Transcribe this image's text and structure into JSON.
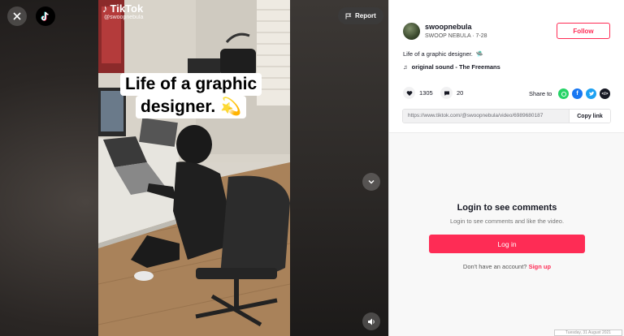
{
  "video": {
    "report_label": "Report",
    "watermark_brand": "TikTok",
    "watermark_handle": "@swoopnebula",
    "caption_line1": "Life of a graphic",
    "caption_line2": "designer. 💫"
  },
  "post": {
    "username": "swoopnebula",
    "display_name": "SWOOP NEBULA",
    "date": "7-28",
    "follow_label": "Follow",
    "description": "Life of a graphic designer. ",
    "description_emoji": "🛸",
    "sound": "original sound - The Freemans",
    "likes": "1305",
    "comments": "20",
    "share_label": "Share to",
    "link_url": "https://www.tiktok.com/@swoopnebula/video/6989680187",
    "copy_link_label": "Copy link"
  },
  "comments": {
    "title": "Login to see comments",
    "subtitle": "Login to see comments and like the video.",
    "login_label": "Log in",
    "no_account": "Don't have an account?",
    "signup_label": "Sign up"
  },
  "footer": {
    "date_stamp": "Tuesday, 31 August 2021"
  },
  "colors": {
    "accent": "#fe2c55",
    "whatsapp": "#25d366",
    "facebook": "#1877f2",
    "twitter": "#1da1f2"
  }
}
